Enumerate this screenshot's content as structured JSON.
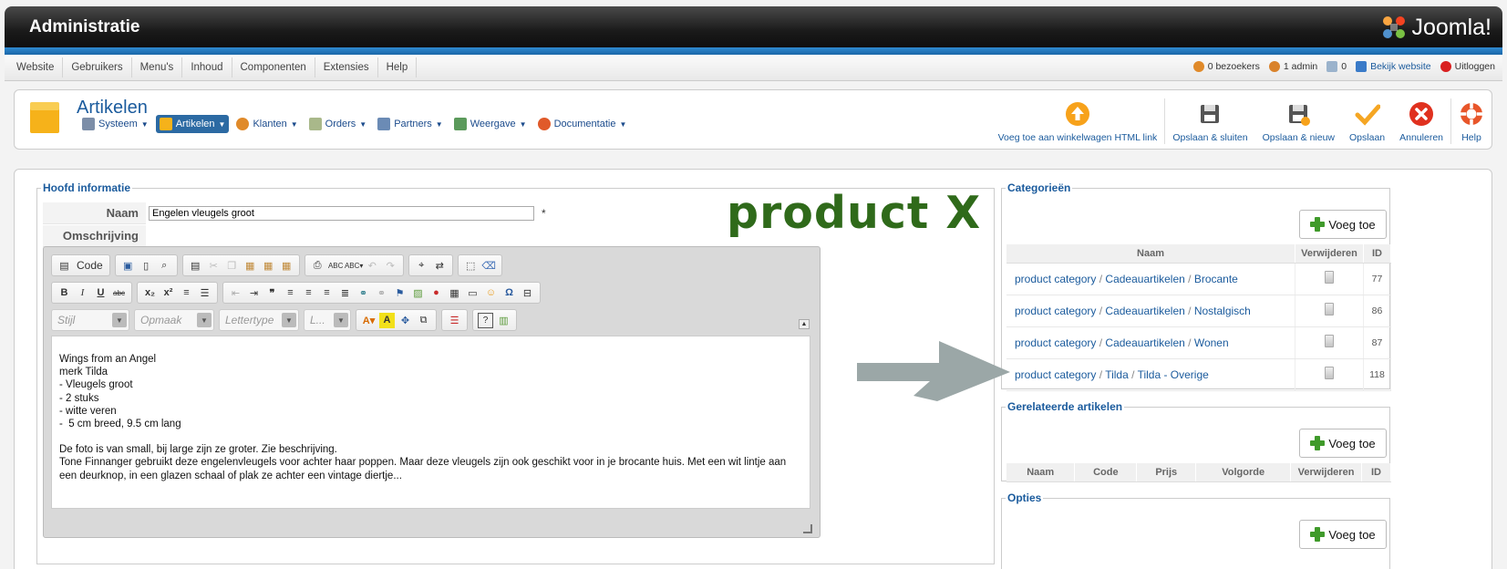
{
  "header": {
    "title": "Administratie",
    "brand": "Joomla!"
  },
  "menubar": {
    "menus": [
      "Website",
      "Gebruikers",
      "Menu's",
      "Inhoud",
      "Componenten",
      "Extensies",
      "Help"
    ],
    "status": {
      "visitors": "0 bezoekers",
      "admins": "1 admin",
      "messages": "0",
      "view_site": "Bekijk website",
      "logout": "Uitloggen"
    }
  },
  "toolbar": {
    "page_title": "Artikelen",
    "submenu": [
      {
        "label": "Systeem",
        "icon": "wrench-icon"
      },
      {
        "label": "Artikelen",
        "icon": "box-icon",
        "active": true
      },
      {
        "label": "Klanten",
        "icon": "users-icon"
      },
      {
        "label": "Orders",
        "icon": "order-icon"
      },
      {
        "label": "Partners",
        "icon": "partners-icon"
      },
      {
        "label": "Weergave",
        "icon": "display-icon"
      },
      {
        "label": "Documentatie",
        "icon": "lifebuoy-icon"
      }
    ],
    "actions": {
      "add_cart": "Voeg toe aan winkelwagen HTML link",
      "save_close": "Opslaan & sluiten",
      "save_new": "Opslaan & nieuw",
      "save": "Opslaan",
      "cancel": "Annuleren",
      "help": "Help"
    }
  },
  "main_info": {
    "legend": "Hoofd informatie",
    "name_label": "Naam",
    "name_value": "Engelen vleugels groot",
    "required": "*",
    "description_label": "Omschrijving"
  },
  "overlay": {
    "product_text": "product X"
  },
  "editor": {
    "code_label": "Code",
    "combos": {
      "style": "Stijl",
      "format": "Opmaak",
      "font": "Lettertype",
      "size": "L..."
    },
    "lines": [
      "Wings from an Angel",
      "merk Tilda",
      "- Vleugels groot",
      "- 2 stuks",
      "- witte veren",
      "-  5 cm breed, 9.5 cm lang"
    ],
    "paragraph1": "De foto is van small, bij large zijn ze groter. Zie beschrijving.",
    "paragraph2": "Tone Finnanger gebruikt deze engelenvleugels voor achter haar poppen. Maar deze vleugels zijn ook geschikt voor in je brocante huis. Met een wit lintje aan een deurknop, in een glazen schaal of plak ze achter een vintage diertje..."
  },
  "categories": {
    "legend": "Categorieën",
    "add_label": "Voeg toe",
    "columns": {
      "name": "Naam",
      "delete": "Verwijderen",
      "id": "ID"
    },
    "rows": [
      {
        "p1": "product category",
        "p2": "Cadeauartikelen",
        "p3": "Brocante",
        "id": "77"
      },
      {
        "p1": "product category",
        "p2": "Cadeauartikelen",
        "p3": "Nostalgisch",
        "id": "86"
      },
      {
        "p1": "product category",
        "p2": "Cadeauartikelen",
        "p3": "Wonen",
        "id": "87"
      },
      {
        "p1": "product category",
        "p2": "Tilda",
        "p3": "Tilda - Overige",
        "id": "118"
      }
    ]
  },
  "related": {
    "legend": "Gerelateerde artikelen",
    "add_label": "Voeg toe",
    "columns": {
      "name": "Naam",
      "code": "Code",
      "price": "Prijs",
      "order": "Volgorde",
      "delete": "Verwijderen",
      "id": "ID"
    }
  },
  "options": {
    "legend": "Opties",
    "add_label": "Voeg toe"
  },
  "colors": {
    "brand_blue": "#1b5b9d",
    "accent_green": "#2f6a1a",
    "header_dark": "#1a1a1a"
  }
}
